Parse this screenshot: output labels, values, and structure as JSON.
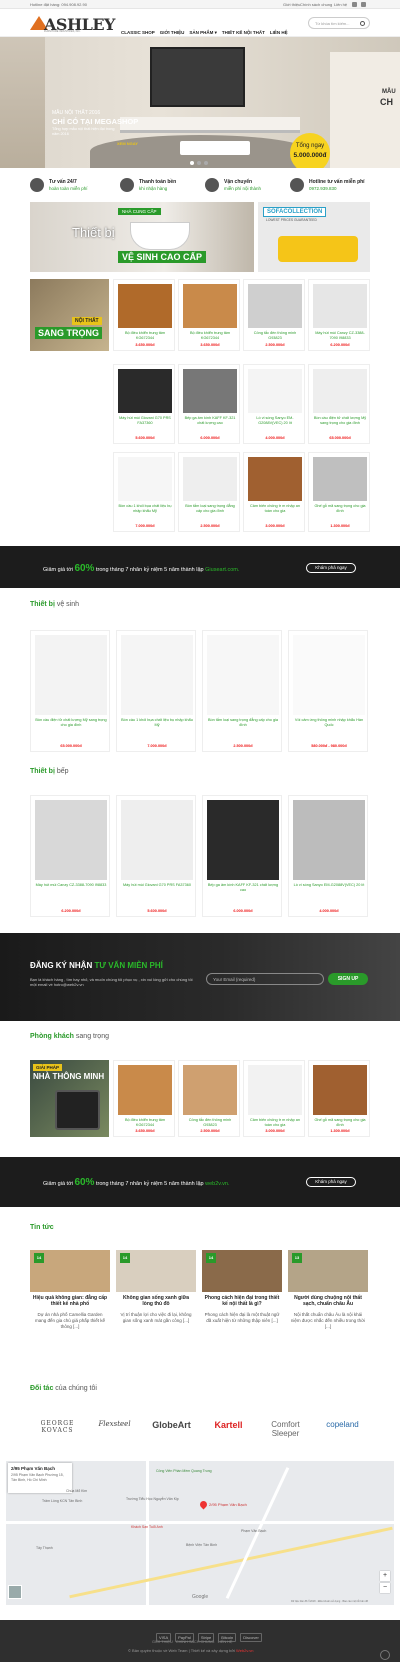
{
  "topbar": {
    "hotline": "Hotline đặt hàng: 094.908.92.90",
    "links": [
      "Giới thiệu",
      "Chính sách chung",
      "Liên hệ"
    ]
  },
  "header": {
    "logo": "ASHLEY",
    "logo_sub": "FURNITURE INDUSTRIES, INC.",
    "nav": [
      "CLASSIC SHOP",
      "GIỚI THIỆU",
      "SẢN PHẨM ▾",
      "THIẾT KẾ NỘI THẤT",
      "LIÊN HỆ"
    ],
    "search_placeholder": "Từ khóa tìm kiếm..."
  },
  "hero": {
    "line1": "MẪU NỘI THẤT 2016",
    "line2": "CHỈ CÓ TẠI MEGASHOP",
    "line3": "Tổng hợp mẫu nội thất hiện đại trong năm 2016",
    "cta": "XEM NGAY",
    "badge1": "Tổng ngay",
    "badge2": "5.000.000đ",
    "right1": "MẪU",
    "right2": "CH"
  },
  "features": [
    {
      "title": "Tư vấn 24/7",
      "sub": "hoàn toàn miễn phí"
    },
    {
      "title": "Thanh toán bền",
      "sub": "khi nhận hàng"
    },
    {
      "title": "Vận chuyển",
      "sub": "miễn phí nội thành"
    },
    {
      "title": "Hotline tư vấn miễn phí",
      "sub": "0972.939.830"
    }
  ],
  "banners": {
    "b1_top": "NHÀ CUNG CẤP",
    "b1_main": "Thiết bị",
    "b1_sub": "VỆ SINH CAO CẤP",
    "b2_main": "SOFACOLLECTION",
    "b2_sub": "LOWEST PRICES GUARANTEED",
    "b3_top": "NỘI THẤT",
    "b3_main": "SANG TRỌNG"
  },
  "grid": [
    {
      "name": "Bộ điều khiển trung tâm KG672344",
      "price": "3.650.000đ"
    },
    {
      "name": "Bộ điều khiển trung tâm KG672344",
      "price": "3.650.000đ"
    },
    {
      "name": "Công tắc đèn thông minh G93823",
      "price": "2.500.000đ"
    },
    {
      "name": "Máy hút mùi Canzy CZ-3388-7090 I98833",
      "price": "6.200.000đ"
    },
    {
      "name": "Máy hút mùi Giovani G70 PRS FA37360",
      "price": "5.600.000đ"
    },
    {
      "name": "Bếp ga âm kính KAFF KF-321 chất lượng cao",
      "price": "6.000.000đ"
    },
    {
      "name": "Lò vi sóng Sanyo EM-G2088V(VEC) 20 lít",
      "price": "4.000.000đ"
    },
    {
      "name": "Bồn cầu điện tử chất lượng Mỹ sang trọng cho gia đình",
      "price": "65.000.000đ"
    },
    {
      "name": "Bồn cầu 1 khối bụa chất liệu bụ nhập khẩu Mỹ",
      "price": "7.000.000đ"
    },
    {
      "name": "Bồn tắm loại sang trọng đẳng cấp cho gia đình",
      "price": "2.500.000đ"
    },
    {
      "name": "Cảm biến chống tr m nhập an toàn cho gia",
      "price": "3.000.000đ"
    },
    {
      "name": "Ghế gỗ mã sang trọng cho gia đình",
      "price": "1.300.000đ"
    }
  ],
  "promo1": {
    "pre": "Giảm giá tới",
    "pct": "60%",
    "post": "trong tháng 7 nhân kỷ niệm 5 năm thành lập",
    "site": "Giuseart.com.",
    "btn": "Khám phá ngay"
  },
  "sec_vesinh": {
    "t1": "Thiết bị",
    "t2": "vệ sinh"
  },
  "vesinh": [
    {
      "name": "Bồn cầu điện tử chất lượng Mỹ sang trọng cho gia đình",
      "price": "65.000.000đ"
    },
    {
      "name": "Bồn cầu 1 khối bụa chất liệu bụ nhập khẩu Mỹ",
      "price": "7.000.000đ"
    },
    {
      "name": "Bồn tắm loại sang trọng đẳng cấp cho gia đình",
      "price": "2.500.000đ"
    },
    {
      "name": "Vòi cảm ứng thông minh nhập khẩu Hàn Quốc",
      "price": "580.000đ - 980.000đ"
    }
  ],
  "sec_bep": {
    "t1": "Thiết bị",
    "t2": "bếp"
  },
  "bep": [
    {
      "name": "Máy hút mùi Canzy CZ-3388-7090 I98833",
      "price": "6.200.000đ"
    },
    {
      "name": "Máy hút mùi Giovani G70 PRS FA37360",
      "price": "5.600.000đ"
    },
    {
      "name": "Bếp ga âm kính KAFF KF-321 chất lượng cao",
      "price": "6.000.000đ"
    },
    {
      "name": "Lò vi sóng Sanyo EM-G2088V(VEC) 20 lít",
      "price": "4.000.000đ"
    }
  ],
  "signup": {
    "t1": "ĐĂNG KÝ NHẬN",
    "t2": "TƯ VẤN MIỄN PHÍ",
    "desc": "Bạn là khách hàng , tìm hay nhỏ, và muốn chúng tôi phục vụ , xin vui lòng gửi cho chúng tôi một email về hotro@web2v.vn",
    "placeholder": "Your Email (required)",
    "btn": "SIGN UP"
  },
  "sec_phongkhach": {
    "t1": "Phòng khách",
    "t2": "sang trọng"
  },
  "pk_banner": {
    "top": "GIẢI PHÁP",
    "main": "NHÀ THÔNG MINH"
  },
  "phongkhach": [
    {
      "name": "Bộ điều khiển trung tâm KG672344",
      "price": "3.650.000đ"
    },
    {
      "name": "Công tắc đèn thông minh G93823",
      "price": "2.500.000đ"
    },
    {
      "name": "Cảm biến chống tr m nhập an toàn cho gia",
      "price": "3.000.000đ"
    },
    {
      "name": "Ghế gỗ mã sang trọng cho gia đình",
      "price": "1.300.000đ"
    }
  ],
  "promo2": {
    "pre": "Giảm giá tới",
    "pct": "60%",
    "post": "trong tháng 7 nhân kỷ niệm 5 năm thành lập",
    "site": "web2v.vn.",
    "btn": "Khám phá ngay"
  },
  "sec_news": {
    "t1": "Tin tức"
  },
  "news": [
    {
      "day": "14",
      "title": "Hiệu quả không gian: đẳng cấp thiết kế nhà phố",
      "desc": "Dự án nhà phố Camellia Garden mang đến gia chủ giá phấp thiết kế thông [...]"
    },
    {
      "day": "14",
      "title": "Không gian sống xanh giữa lòng thủ đô",
      "desc": "Vị trí thuận lợi cho việc đi lại, không gian sống xanh mát gần công [...]"
    },
    {
      "day": "14",
      "title": "Phong cách hiện đại trong thiết kế nội thất là gì?",
      "desc": "Phong cách hiện đại là một thuật ngữ đã xuất hiện từ những thập niên [...]"
    },
    {
      "day": "13",
      "title": "Người dùng chuộng nội thất sạch, chuẩn châu Âu",
      "desc": "Nội thất chuẩn châu Âu là nội khái niệm được nhắc đến nhiều trong thời [...]"
    }
  ],
  "sec_partner": {
    "t1": "Đối tác",
    "t2": "của chúng tôi"
  },
  "partners": [
    "GEORGE KOVACS",
    "Flexsteel",
    "GlobeArt",
    "Kartell",
    "Comfort Sleeper",
    "copeland"
  ],
  "map": {
    "addr_title": "2/95 Phạm Văn Bạch",
    "addr": "2/95 Phạm Văn Bạch Phường 15, Tân Bình, Hồ Chí Minh",
    "pin": "2/95 Phạm Văn Bạch",
    "places": [
      "Công Viên Phần Mềm Quang Trung",
      "Trâm Lồng KCN Tân Bình",
      "Chùa Mổ Kim",
      "Trường Tiểu Học Nguyễn Văn Kịp",
      "Khách Sạn Tuổi Anh",
      "Phạm Văn Bạch",
      "Bệnh Viện Tân Bình",
      "Tây Thạnh"
    ],
    "google": "Google",
    "credit": "Dữ liệu bản đồ ©2018 · Điều khoản sử dụng · Báo cáo một lỗi bản đồ"
  },
  "footer": {
    "pay": [
      "VISA",
      "PayPal",
      "Stripe",
      "Bitcoin",
      "Discover"
    ],
    "links": [
      "GIỚI THIỆU",
      "CHÍNH SÁCH CHUNG",
      "LIÊN HỆ"
    ],
    "copy": "© Bản quyền thuộc về Web Team | Thiết kế và xây dựng bởi",
    "brand": "Web2v.vn"
  }
}
